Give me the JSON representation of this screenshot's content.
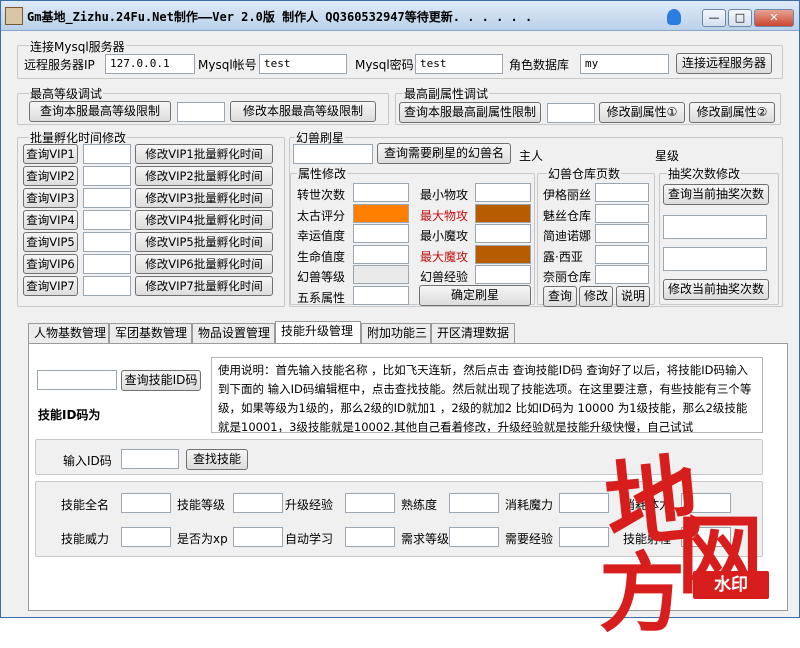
{
  "window": {
    "title": "Gm基地_Zizhu.24Fu.Net制作——Ver 2.0版  制作人 QQ360532947等待更新. . . . . .",
    "min": "—",
    "max": "□",
    "close": "✕"
  },
  "mysql": {
    "legend": "连接Mysql服务器",
    "host_label": "远程服务器IP",
    "host_value": "127.0.0.1",
    "user_label": "Mysql帐号",
    "user_value": "test",
    "pass_label": "Mysql密码",
    "pass_value": "test",
    "db_label": "角色数据库",
    "db_value": "my",
    "connect_button": "连接远程服务器"
  },
  "max_level": {
    "legend": "最高等级调试",
    "query_button": "查询本服最高等级限制",
    "value": "",
    "modify_button": "修改本服最高等级限制"
  },
  "max_sub": {
    "legend": "最高副属性调试",
    "query_button": "查询本服最高副属性限制",
    "value": "",
    "modify1_button": "修改副属性①",
    "modify2_button": "修改副属性②"
  },
  "vip": {
    "legend": "批量孵化时间修改",
    "rows": [
      {
        "query": "查询VIP1",
        "modify": "修改VIP1批量孵化时间"
      },
      {
        "query": "查询VIP2",
        "modify": "修改VIP2批量孵化时间"
      },
      {
        "query": "查询VIP3",
        "modify": "修改VIP3批量孵化时间"
      },
      {
        "query": "查询VIP4",
        "modify": "修改VIP4批量孵化时间"
      },
      {
        "query": "查询VIP5",
        "modify": "修改VIP5批量孵化时间"
      },
      {
        "query": "查询VIP6",
        "modify": "修改VIP6批量孵化时间"
      },
      {
        "query": "查询VIP7",
        "modify": "修改VIP7批量孵化时间"
      }
    ]
  },
  "pet": {
    "legend": "幻兽刷星",
    "query_button": "查询需要刷星的幻兽名",
    "owner_label": "主人",
    "star_label": "星级",
    "attr_legend": "属性修改",
    "left_labels": [
      "转世次数",
      "太古评分",
      "幸运值度",
      "生命值度",
      "幻兽等级",
      "五系属性"
    ],
    "right_labels": [
      "最小物攻",
      "最大物攻",
      "最小魔攻",
      "最大魔攻",
      "幻兽经验"
    ],
    "confirm_button": "确定刷星"
  },
  "warehouse": {
    "legend": "幻兽仓库页数",
    "labels": [
      "伊格丽丝",
      "魅丝仓库",
      "简迪诺娜",
      "露·西亚",
      "奈丽仓库"
    ],
    "query_button": "查询",
    "modify_button": "修改",
    "help_button": "说明"
  },
  "lottery": {
    "legend": "抽奖次数修改",
    "query_button": "查询当前抽奖次数",
    "modify_button": "修改当前抽奖次数"
  },
  "tabs": [
    "人物基数管理",
    "军团基数管理",
    "物品设置管理",
    "技能升级管理",
    "附加功能三",
    "开区清理数据"
  ],
  "skill": {
    "query_button": "查询技能ID码",
    "id_title": "技能ID码为",
    "help_text": "使用说明：首先输入技能名称 ，比如飞天连斩，然后点击 查询技能ID码 查询好了以后，将技能ID码输入到下面的 输入ID码编辑框中，点击查找技能。然后就出现了技能选项。在这里要注意，有些技能有三个等级，如果等级为1级的，那么2级的ID就加1 ，2级的就加2 比如ID码为 10000 为1级技能，那么2级技能就是10001，3级技能就是10002.其他自己看着修改，升级经验就是技能升级快慢，自己试试",
    "input_id_label": "输入ID码",
    "find_button": "查找技能",
    "row1_labels": [
      "技能全名",
      "技能等级",
      "升级经验",
      "熟练度",
      "消耗魔力",
      "消耗体力"
    ],
    "row2_labels": [
      "技能威力",
      "是否为xp",
      "自动学习",
      "需求等级",
      "需要经验",
      "技能射程"
    ]
  },
  "watermark": {
    "c1": "地",
    "c2": "网",
    "c3": "方",
    "badge": "水印",
    "color": "#d81d1d"
  }
}
